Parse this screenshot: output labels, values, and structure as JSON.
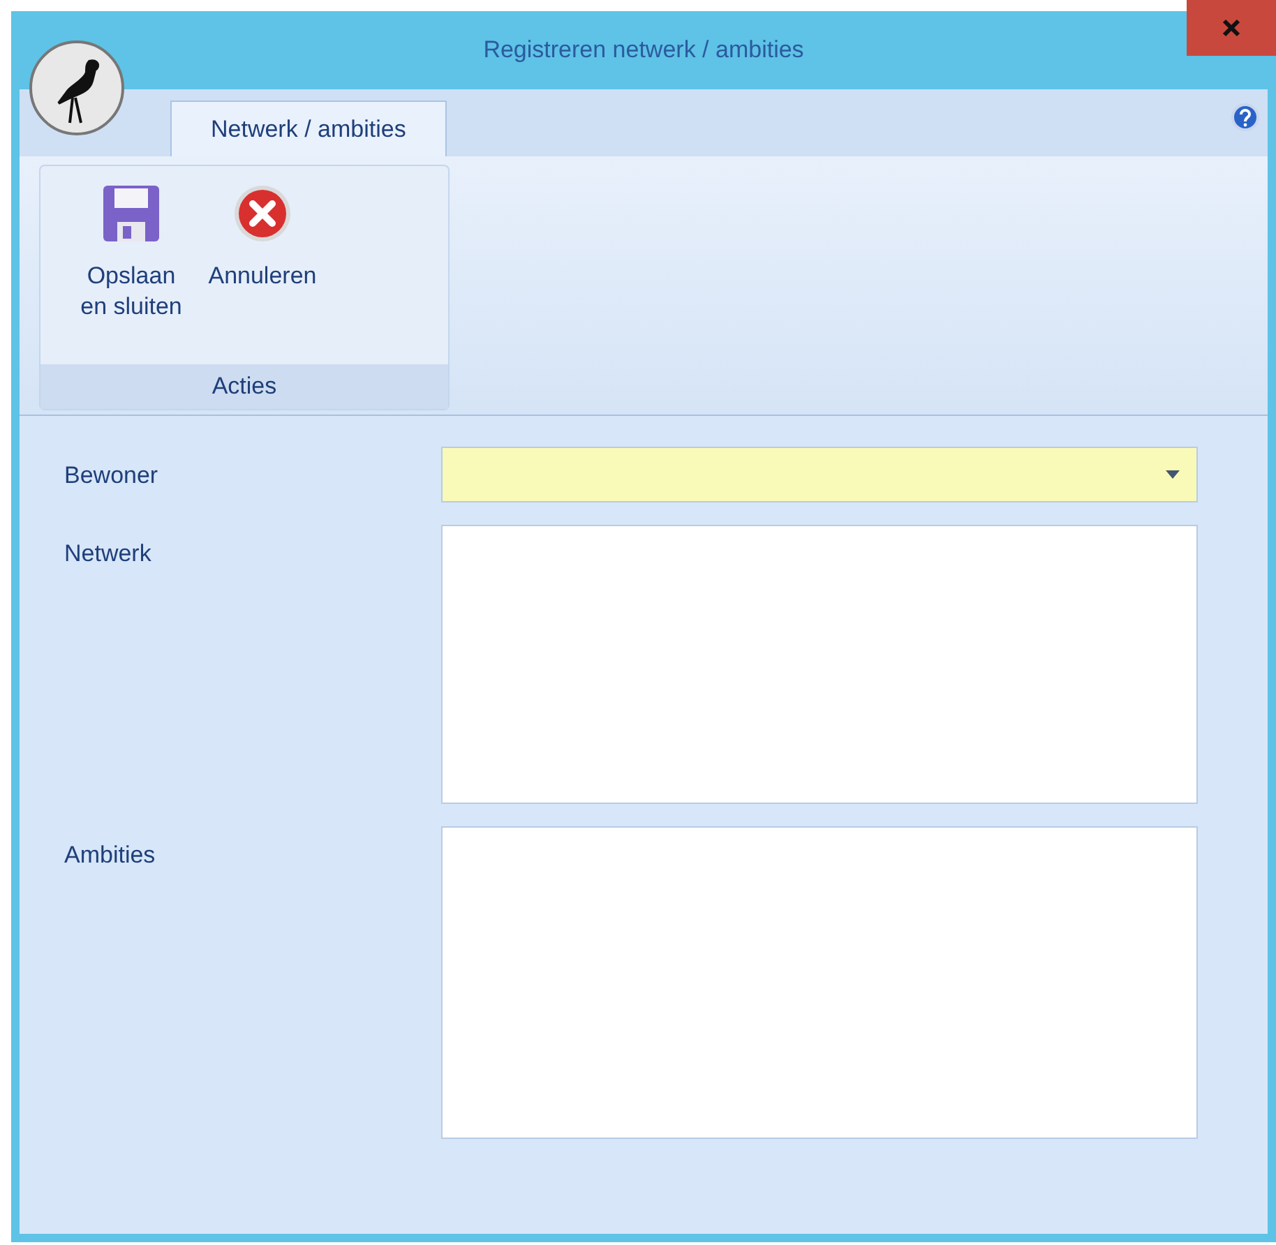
{
  "window": {
    "title": "Registreren netwerk / ambities"
  },
  "tabs": [
    {
      "label": "Netwerk / ambities",
      "selected": true
    }
  ],
  "ribbon": {
    "groups": [
      {
        "label": "Acties",
        "buttons": [
          {
            "kind": "save",
            "label": "Opslaan en sluiten"
          },
          {
            "kind": "cancel",
            "label": "Annuleren"
          }
        ]
      }
    ]
  },
  "form": {
    "fields": [
      {
        "label": "Bewoner",
        "kind": "combo",
        "required": true
      },
      {
        "label": "Netwerk",
        "kind": "memo",
        "required": false
      },
      {
        "label": "Ambities",
        "kind": "memo",
        "required": false
      }
    ]
  }
}
